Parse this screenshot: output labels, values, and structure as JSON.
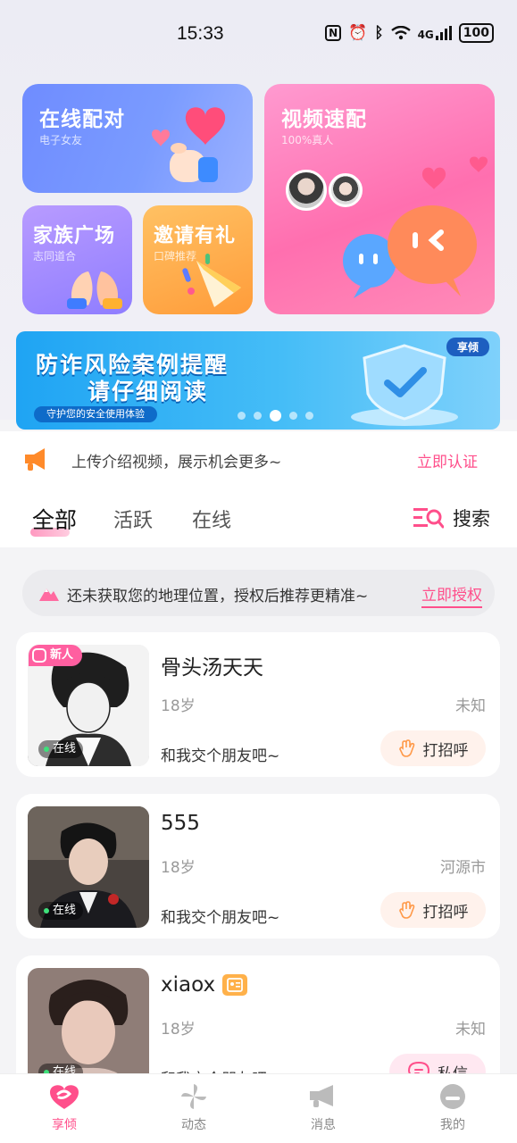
{
  "status_bar": {
    "time": "15:33",
    "network": "4G",
    "battery": "100"
  },
  "feature_cards": {
    "match": {
      "title": "在线配对",
      "subtitle": "电子女友"
    },
    "video": {
      "title": "视频速配",
      "subtitle": "100%真人"
    },
    "family": {
      "title": "家族广场",
      "subtitle": "志同道合"
    },
    "invite": {
      "title": "邀请有礼",
      "subtitle": "口碑推荐"
    }
  },
  "banner": {
    "line1": "防诈风险案例提醒",
    "line2": "请仔细阅读",
    "subtitle": "守护您的安全使用体验",
    "tag": "享倾",
    "active_slide": 2,
    "slide_count": 5
  },
  "notice": {
    "text": "上传介绍视频，展示机会更多~",
    "link": "立即认证"
  },
  "tabs": {
    "all": "全部",
    "active": "活跃",
    "online": "在线",
    "search": "搜索"
  },
  "location": {
    "text": "还未获取您的地理位置，授权后推荐更精准~",
    "link": "立即授权"
  },
  "users": [
    {
      "name": "骨头汤天天",
      "age": "18岁",
      "city": "未知",
      "bio": "和我交个朋友吧~",
      "status": "在线",
      "badge": "新人",
      "action": "打招呼"
    },
    {
      "name": "555",
      "age": "18岁",
      "city": "河源市",
      "bio": "和我交个朋友吧~",
      "status": "在线",
      "action": "打招呼"
    },
    {
      "name": "xiaox",
      "age": "18岁",
      "city": "未知",
      "bio": "和我交个朋友吧~",
      "status": "在线",
      "action": "私信"
    }
  ],
  "bottom_nav": {
    "home": "享倾",
    "moments": "动态",
    "messages": "消息",
    "mine": "我的"
  },
  "colors": {
    "accent": "#ff4f8b",
    "match_card": "#7a9bff",
    "video_card": "#ff6faf",
    "family_card": "#9b87ff",
    "invite_card": "#ffa84a",
    "banner": "#1fa4f3"
  }
}
